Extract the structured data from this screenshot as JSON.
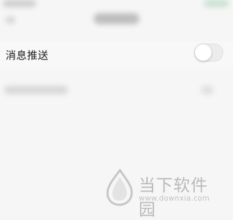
{
  "settings": {
    "push_label": "消息推送",
    "push_enabled": false
  },
  "watermark": {
    "brand": "当下软件园",
    "url": "www.downxia.com",
    "logo_icon": "downxia-logo-icon"
  },
  "colors": {
    "background": "#f6f6f6",
    "toggle_off": "#ececec",
    "watermark": "#bdbdbd"
  }
}
